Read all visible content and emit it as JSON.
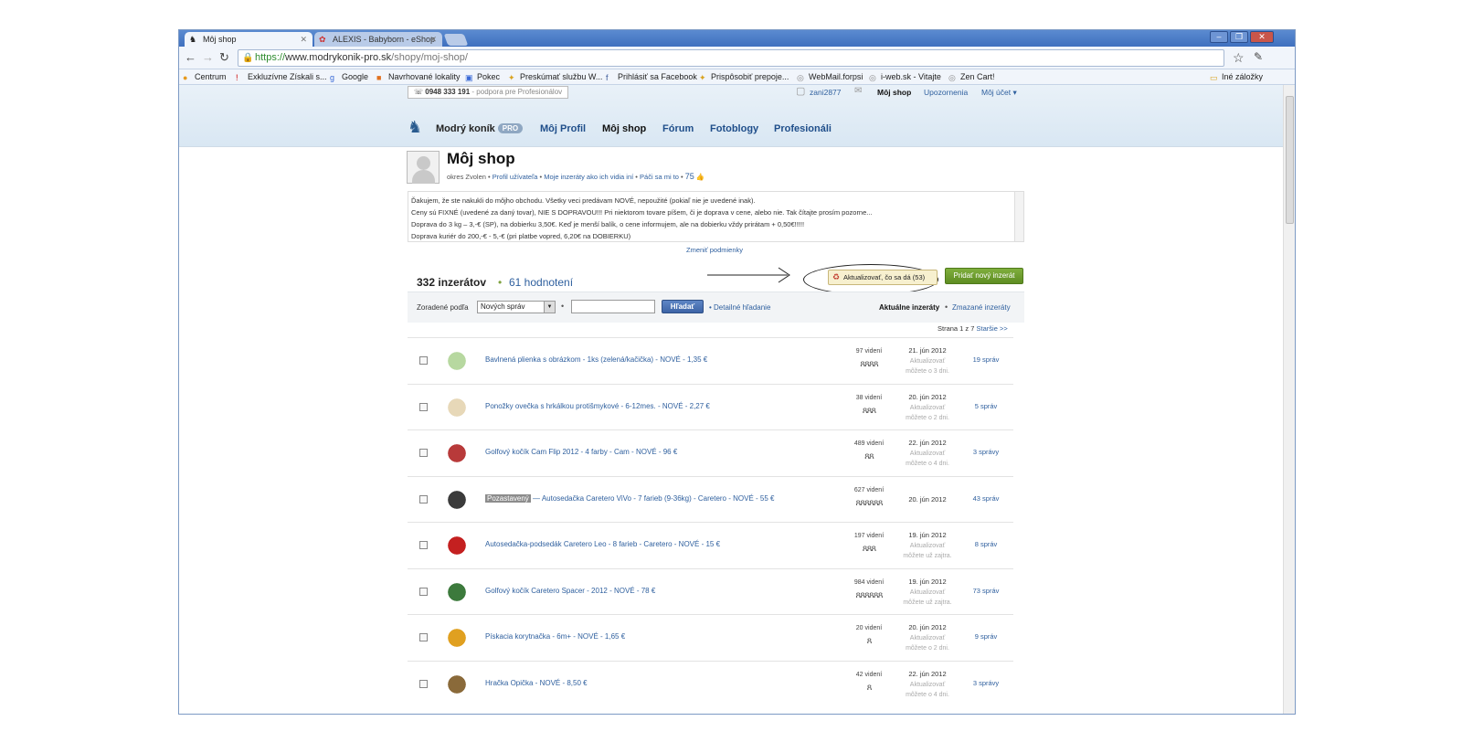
{
  "browser": {
    "tabs": [
      {
        "title": "Môj shop",
        "active": true
      },
      {
        "title": "ALEXIS - Babyborn - eShop",
        "active": false
      }
    ],
    "url": {
      "scheme": "https://",
      "host": "www.modrykonik-pro.sk",
      "path": "/shopy/moj-shop/"
    },
    "bookmarks": [
      "Centrum",
      "Exkluzívne Získali s...",
      "Google",
      "Navrhované lokality",
      "Pokec",
      "Preskúmať službu W...",
      "Prihlásiť sa Facebook",
      "Prispôsobiť prepoje...",
      "WebMail.forpsi",
      "i-web.sk - Vitajte",
      "Zen Cart!",
      "Iné záložky"
    ]
  },
  "header": {
    "phone": "0948 333 191",
    "phone_note": "- podpora pre Profesionálov",
    "username": "zani2877",
    "my_shop": "Môj shop",
    "notifications": "Upozornenia",
    "my_account": "Môj účet ▾",
    "logo": "Modrý koník",
    "logo_badge": "PRO",
    "nav": [
      "Môj Profil",
      "Môj shop",
      "Fórum",
      "Fotoblogy",
      "Profesionáli"
    ]
  },
  "profile": {
    "title": "Môj shop",
    "district": "okres Zvolen",
    "profile_link": "Profil užívateľa",
    "view_as_others": "Moje inzeráty ako ich vidia iní",
    "like_text": "Páči sa mi to",
    "like_count": "75"
  },
  "conditions": {
    "lines": [
      "Ďakujem, že ste nakukli do môjho obchodu. Všetky veci predávam NOVÉ, nepoužité (pokiaľ nie je uvedené inak).",
      "Ceny sú FIXNÉ (uvedené za daný tovar), NIE S DOPRAVOU!!! Pri niektorom tovare píšem, či je doprava v cene, alebo nie. Tak čítajte prosím pozorne...",
      "Doprava do 3 kg – 3,-€ (SP), na dobierku 3,50€. Keď je menší balík, o cene informujem, ale na dobierku vždy prirátam + 0,50€!!!!!",
      "Doprava kuriér do 200,-€ - 5,-€ (pri platbe vopred, 6,20€ na DOBIERKU)"
    ],
    "change_link": "Zmeniť podmienky"
  },
  "stats": {
    "listings": "332 inzerátov",
    "ratings": "61 hodnotení",
    "update_button": "Aktualizovať, čo sa dá (53)",
    "add_button": "Pridať nový inzerát"
  },
  "filter": {
    "sort_label": "Zoradené podľa",
    "sort_value": "Nových správ",
    "search_value": "",
    "search_button": "Hľadať",
    "advanced": "Detailné hľadanie",
    "current": "Aktuálne inzeráty",
    "deleted": "Zmazané inzeráty",
    "page_info": "Strana 1 z 7",
    "older": "Staršie  >>"
  },
  "listings": [
    {
      "title": "Bavlnená plienka s obrázkom - 1ks (zelená/kačička) - NOVÉ - 1,35 €",
      "paused": "",
      "views": "97 videní",
      "people": "ጸጸጸጸ",
      "date": "21. jún 2012",
      "update": "Aktualizovať\nmôžete o 3 dni.",
      "msgs": "19 správ",
      "thumb_color": "#b7d8a0"
    },
    {
      "title": "Ponožky ovečka s hrkálkou protišmykové - 6-12mes. - NOVÉ - 2,27 €",
      "paused": "",
      "views": "38 videní",
      "people": "ጸጸጸ",
      "date": "20. jún 2012",
      "update": "Aktualizovať\nmôžete o 2 dni.",
      "msgs": "5 správ",
      "thumb_color": "#e7d8b8"
    },
    {
      "title": "Golfový kočík Cam Flip 2012 - 4 farby - Cam - NOVÉ - 96 €",
      "paused": "",
      "views": "489 videní",
      "people": "ጸጸ",
      "date": "22. jún 2012",
      "update": "Aktualizovať\nmôžete o 4 dni.",
      "msgs": "3 správy",
      "thumb_color": "#b83a3a"
    },
    {
      "title": "— Autosedačka Caretero ViVo - 7 farieb (9-36kg) - Caretero - NOVÉ - 55 €",
      "paused": "Pozastavený",
      "views": "627 videní",
      "people": "ጸጸጸጸጸጸ",
      "date": "20. jún 2012",
      "update": "",
      "msgs": "43 správ",
      "thumb_color": "#3b3b3b"
    },
    {
      "title": "Autosedačka-podsedák Caretero Leo - 8 farieb - Caretero - NOVÉ - 15 €",
      "paused": "",
      "views": "197 videní",
      "people": "ጸጸጸ",
      "date": "19. jún 2012",
      "update": "Aktualizovať\nmôžete už zajtra.",
      "msgs": "8 správ",
      "thumb_color": "#c42020"
    },
    {
      "title": "Golfový kočík Caretero Spacer - 2012 - NOVÉ - 78 €",
      "paused": "",
      "views": "984 videní",
      "people": "ጸጸጸጸጸጸ",
      "date": "19. jún 2012",
      "update": "Aktualizovať\nmôžete už zajtra.",
      "msgs": "73 správ",
      "thumb_color": "#3c7a3c"
    },
    {
      "title": "Pískacia korytnačka - 6m+ - NOVÉ - 1,65 €",
      "paused": "",
      "views": "20 videní",
      "people": "ጸ",
      "date": "20. jún 2012",
      "update": "Aktualizovať\nmôžete o 2 dni.",
      "msgs": "9 správ",
      "thumb_color": "#e0a020"
    },
    {
      "title": "Hračka Opička - NOVÉ - 8,50 €",
      "paused": "",
      "views": "42 videní",
      "people": "ጸ",
      "date": "22. jún 2012",
      "update": "Aktualizovať\nmôžete o 4 dni.",
      "msgs": "3 správy",
      "thumb_color": "#8a6a3a"
    }
  ],
  "colors": {
    "link": "#2e5f9e",
    "accent_green": "#6b9a2c",
    "header_bg": "#e3edf6"
  }
}
